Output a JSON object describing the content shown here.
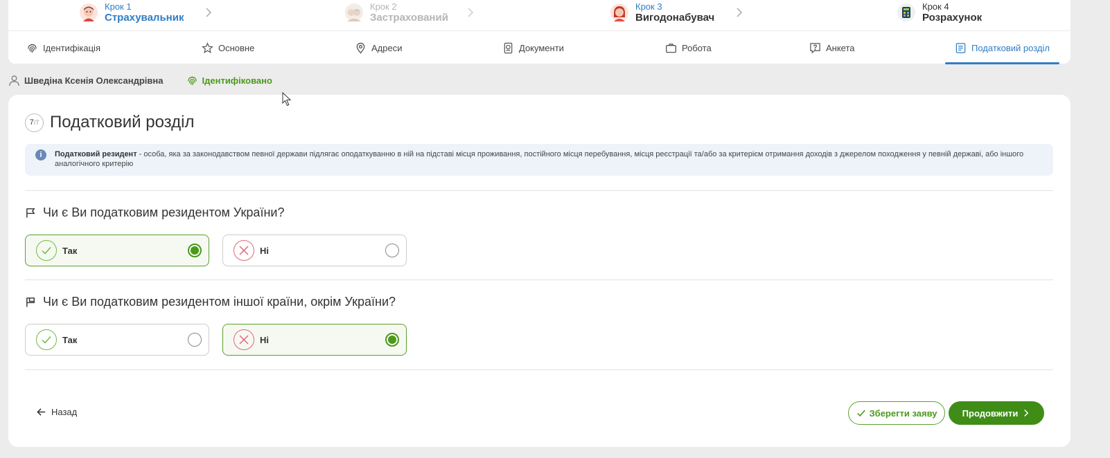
{
  "steps": [
    {
      "num": "Крок 1",
      "name": "Страхувальник",
      "state": "active",
      "color_num": "#2f7dc4",
      "color_name": "#2f7dc4"
    },
    {
      "num": "Крок 2",
      "name": "Застрахований",
      "state": "disabled",
      "color_num": "#b5b5b5",
      "color_name": "#b5b5b5"
    },
    {
      "num": "Крок 3",
      "name": "Вигодонабувач",
      "state": "default",
      "color_num": "#2f7dc4",
      "color_name": "#333333"
    },
    {
      "num": "Крок 4",
      "name": "Розрахунок",
      "state": "default",
      "color_num": "#333333",
      "color_name": "#333333"
    }
  ],
  "tabs": [
    {
      "label": "Ідентифікація",
      "icon": "fingerprint-icon"
    },
    {
      "label": "Основне",
      "icon": "star-icon"
    },
    {
      "label": "Адреси",
      "icon": "map-pin-icon"
    },
    {
      "label": "Документи",
      "icon": "passport-icon"
    },
    {
      "label": "Робота",
      "icon": "briefcase-icon"
    },
    {
      "label": "Анкета",
      "icon": "question-icon"
    },
    {
      "label": "Податковий розділ",
      "icon": "document-icon",
      "active": true
    }
  ],
  "user": {
    "name": "Шведіна Ксенія Олександрівна",
    "identified": "Ідентифіковано"
  },
  "section": {
    "step_current": "7",
    "step_total": "/7",
    "title": "Податковий розділ"
  },
  "info": {
    "term": "Податковий резидент",
    "text": " - особа, яка за законодавством певної держави підлягає оподаткуванню в ній на підставі місця проживання, постійного місця перебування, місця реєстрації та/або за критерієм отримання доходів з джерелом походження у певній державі, або іншого аналогічного критерію"
  },
  "questions": [
    {
      "text": "Чи є Ви податковим резидентом України?",
      "icon": "flag-icon",
      "options": [
        {
          "label": "Так",
          "selected": true
        },
        {
          "label": "Ні",
          "selected": false
        }
      ]
    },
    {
      "text": "Чи є Ви податковим резидентом іншої країни, окрім України?",
      "icon": "flag-alt-icon",
      "options": [
        {
          "label": "Так",
          "selected": false
        },
        {
          "label": "Ні",
          "selected": true
        }
      ]
    }
  ],
  "actions": {
    "back": "Назад",
    "save": "Зберегти заяву",
    "next": "Продовжити"
  },
  "colors": {
    "accent_blue": "#2f7dc4",
    "accent_green": "#4a9a1a",
    "primary_button": "#3f8d17",
    "info_bg": "#eef3f9"
  }
}
